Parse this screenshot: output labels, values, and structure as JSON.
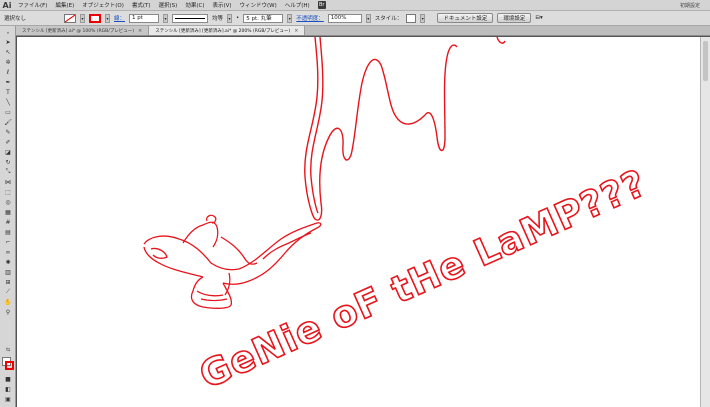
{
  "app": {
    "logo": "Ai"
  },
  "menu": {
    "items": [
      "ファイル(F)",
      "編集(E)",
      "オブジェクト(O)",
      "書式(T)",
      "選択(S)",
      "効果(C)",
      "表示(V)",
      "ウィンドウ(W)",
      "ヘルプ(H)"
    ],
    "workspace": "初期設定"
  },
  "control": {
    "selection": "選択なし",
    "stroke_label": "線：",
    "stroke_weight": "1 pt",
    "stroke_profile": "均等",
    "brush": "5 pt. 丸筆",
    "opacity_label": "不透明度：",
    "opacity_value": "100%",
    "style_label": "スタイル：",
    "doc_settings_button": "ドキュメント設定",
    "preferences_button": "環境設定"
  },
  "tabs": [
    {
      "label": "ステンシル [更新済み].ai* @ 100% (RGB/プレビュー)"
    },
    {
      "label": "ステンシル [更新済み] [更新済み].ai* @ 200% (RGB/プレビュー)"
    }
  ],
  "artwork": {
    "text": "GeNie oF tHe LaMP???",
    "stroke_color": "#e8141b"
  },
  "colors": {
    "stroke": "#e8141b",
    "ui_bg": "#d6d6d6"
  }
}
